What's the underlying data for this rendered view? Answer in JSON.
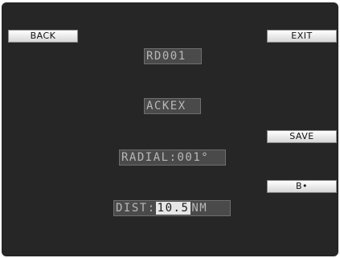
{
  "buttons": {
    "back": "BACK",
    "exit": "EXIT",
    "save": "SAVE",
    "b_arrow": "B•"
  },
  "fields": {
    "id": "RD001",
    "type": "ACKEX",
    "radial": "RADIAL:001°",
    "dist_label": "DIST:",
    "dist_value": "10.5",
    "dist_unit": "NM"
  }
}
